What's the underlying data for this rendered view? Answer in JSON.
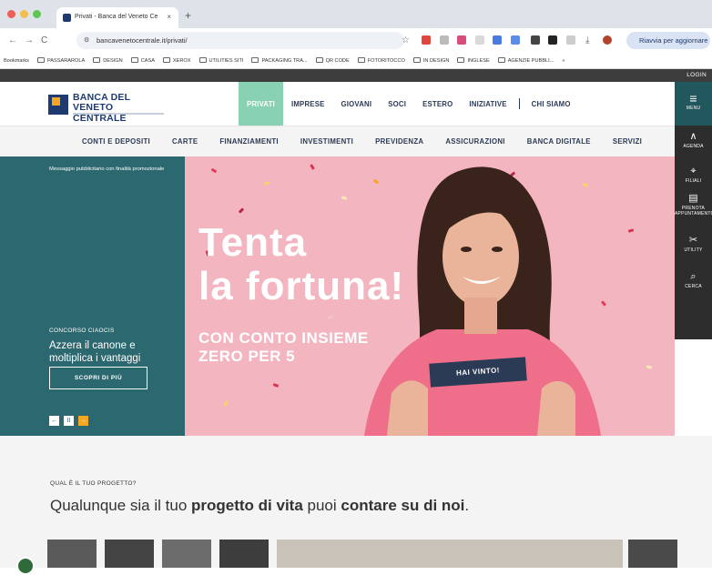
{
  "browser": {
    "tab_title": "Privati - Banca del Veneto Ce",
    "tab_close": "×",
    "new_tab": "+",
    "url": "bancavenetocentrale.it/privati/",
    "update_label": "Riavvia per aggiornare",
    "bookmarks": [
      "Bookmarks",
      "PASSARAROLA",
      "DESIGN",
      "CASA",
      "XEROX",
      "UTILITIES SITI",
      "PACKAGING TRA...",
      "QR CODE",
      "FOTORITOCCO",
      "IN DESIGN",
      "INGLESE",
      "AGENZIE PUBBLI..."
    ],
    "bookmarks_more": "»",
    "colors": {
      "close": "#ee5e57",
      "minimize": "#f5bd4f",
      "maximize": "#5fc453"
    }
  },
  "site": {
    "login": "LOGIN",
    "logo": {
      "line1": "BANCA DEL",
      "line2": "VENETO CENTRALE"
    },
    "main_nav": [
      "PRIVATI",
      "IMPRESE",
      "GIOVANI",
      "SOCI",
      "ESTERO",
      "INIZIATIVE",
      "CHI SIAMO"
    ],
    "sub_nav": [
      "CONTI E DEPOSITI",
      "CARTE",
      "FINANZIAMENTI",
      "INVESTIMENTI",
      "PREVIDENZA",
      "ASSICURAZIONI",
      "BANCA DIGITALE",
      "SERVIZI"
    ],
    "rail": {
      "menu": "MENU",
      "agenda": "AGENDA",
      "filiali": "FILIALI",
      "appuntamento": "PRENOTA APPUNTAMENTO",
      "utility": "UTILITY",
      "cerca": "CERCA"
    },
    "colors": {
      "brand": "#1e3a6e",
      "accent": "#f5a623",
      "nav_active": "#89d1b3",
      "teal": "#2c6870",
      "rail_menu": "#20585d"
    }
  },
  "hero": {
    "promo_note": "Messaggio pubblicitario con finalità promozionale",
    "kicker": "CONCORSO CIAOCIS",
    "subtitle": "Azzera il canone e moltiplica i vantaggi",
    "cta": "SCOPRI DI PIÙ",
    "title_line1": "Tenta",
    "title_line2": "la fortuna!",
    "product_line1": "CON CONTO INSIEME",
    "product_line2": "ZERO PER 5",
    "ticket": "HAI VINTO!",
    "controls": {
      "prev": "←",
      "pause": "II",
      "play": "→"
    }
  },
  "section": {
    "kicker": "QUAL È IL TUO PROGETTO?",
    "heading_pre": "Qualunque sia il tuo ",
    "heading_bold1": "progetto di vita",
    "heading_mid": " puoi ",
    "heading_bold2": "contare su di noi",
    "heading_end": "."
  }
}
